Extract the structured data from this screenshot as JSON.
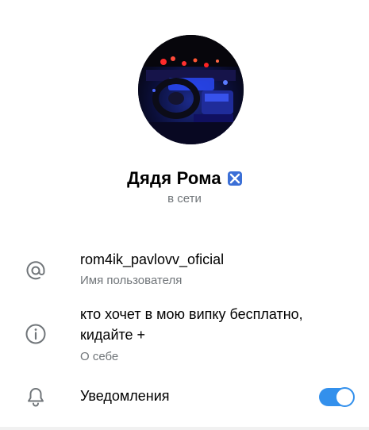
{
  "profile": {
    "name": "Дядя Рома",
    "status": "в сети"
  },
  "username": {
    "value": "rom4ik_pavlovv_oficial",
    "label": "Имя пользователя",
    "icon": "at-icon"
  },
  "bio": {
    "line1": "кто хочет в мою випку бесплатно,",
    "line2": "кидайте +",
    "label": "О себе",
    "icon": "info-icon"
  },
  "notifications": {
    "label": "Уведомления",
    "icon": "bell-icon",
    "enabled": true
  },
  "colors": {
    "accent": "#3390ec",
    "secondary_text": "#707579",
    "badge": "#3b6fd6"
  }
}
